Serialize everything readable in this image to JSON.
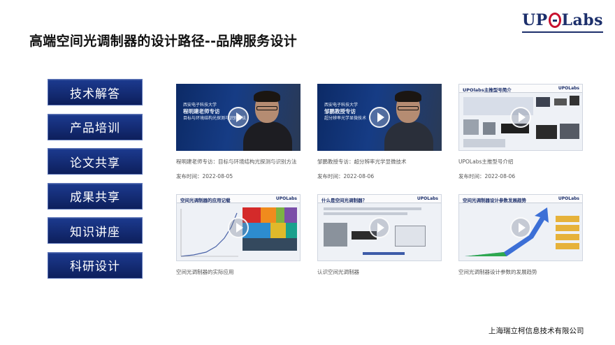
{
  "header": {
    "title": "高端空间光调制器的设计路径--品牌服务设计",
    "logo": "UPOLabs",
    "logo_pre": "UP",
    "logo_post": "Labs"
  },
  "nav": {
    "items": [
      {
        "label": "技术解答"
      },
      {
        "label": "产品培训"
      },
      {
        "label": "论文共享"
      },
      {
        "label": "成果共享"
      },
      {
        "label": "知识讲座"
      },
      {
        "label": "科研设计"
      }
    ]
  },
  "videos": [
    {
      "caption": "程明建老师专访：目标与环境结构光探测与识别方法",
      "date": "发布时间：2022-08-05",
      "thumb_line1": "西安电子科技大学",
      "thumb_line2": "程明建老师专访",
      "thumb_line3": "目标与环境结构光探测与识别方法"
    },
    {
      "caption": "邹鹏教授专访：超分辨率光学显微技术",
      "date": "发布时间：2022-08-06",
      "thumb_line1": "西安电子科技大学",
      "thumb_line2": "邹鹏教授专访",
      "thumb_line3": "超分辨率光学显微技术"
    },
    {
      "caption": "UPOLabs主推型号介绍",
      "date": "发布时间：2022-08-06",
      "thumb_title": "UPOlabs主推型号简介"
    },
    {
      "caption": "空间光调制器的实际应用",
      "thumb_title": "空间光调制器的应用记载"
    },
    {
      "caption": "认识空间光调制器",
      "thumb_title": "什么是空间光调制器？"
    },
    {
      "caption": "空间光调制器设计参数的发展趋势",
      "thumb_title": "空间光调制器设计参数发展趋势"
    }
  ],
  "footer": {
    "company": "上海瑞立柯信息技术有限公司"
  }
}
